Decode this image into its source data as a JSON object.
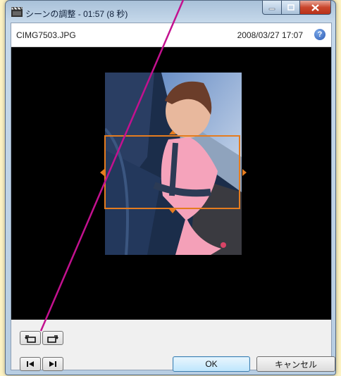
{
  "window": {
    "title": "シーンの調整 - 01:57 (8 秒)"
  },
  "info": {
    "filename": "CIMG7503.JPG",
    "datetime": "2008/03/27 17:07",
    "help_label": "?"
  },
  "buttons": {
    "ok": "OK",
    "cancel": "キャンセル"
  },
  "icons": {
    "title": "clapperboard-icon",
    "help": "help-icon",
    "rotate_left": "rotate-left-icon",
    "rotate_right": "rotate-right-icon",
    "previous": "skip-previous-icon",
    "next": "skip-next-icon"
  },
  "colors": {
    "crop_frame": "#e57c1f",
    "annotation_line": "#c3118f",
    "page_background": "#fdf3c4"
  }
}
